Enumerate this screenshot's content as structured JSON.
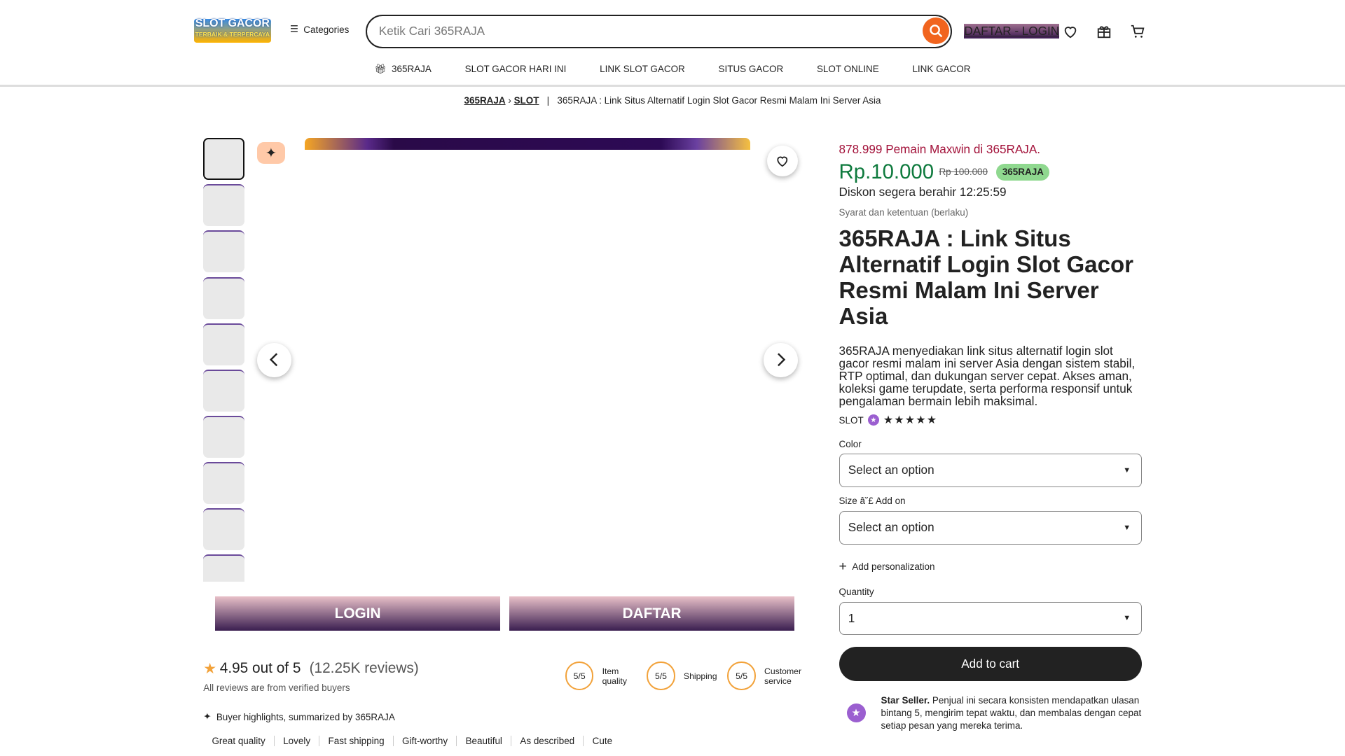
{
  "header": {
    "logo_text": "SLOT GACOR",
    "logo_sub": "TERBAIK & TERPERCAYA",
    "categories": "Categories",
    "search_placeholder": "Ketik Cari 365RAJA",
    "login_link": "DAFTAR - LOGIN"
  },
  "nav": [
    "365RAJA",
    "SLOT GACOR HARI INI",
    "LINK SLOT GACOR",
    "SITUS GACOR",
    "SLOT ONLINE",
    "LINK GACOR"
  ],
  "breadcrumb": {
    "items": [
      "365RAJA",
      "SLOT"
    ],
    "current": "365RAJA : Link Situs Alternatif Login Slot Gacor Resmi Malam Ini Server Asia",
    "sep": "|"
  },
  "gallery": {
    "login": "LOGIN",
    "daftar": "DAFTAR"
  },
  "reviews": {
    "score": "4.95 out of 5",
    "count": "(12.25K reviews)",
    "verified": "All reviews are from verified buyers",
    "scores": [
      {
        "v": "5/5",
        "l": "Item quality"
      },
      {
        "v": "5/5",
        "l": "Shipping"
      },
      {
        "v": "5/5",
        "l": "Customer service"
      }
    ],
    "highlights": "Buyer highlights, summarized by 365RAJA",
    "tags": [
      "Great quality",
      "Lovely",
      "Fast shipping",
      "Gift-worthy",
      "Beautiful",
      "As described",
      "Cute"
    ]
  },
  "product": {
    "promo": "878.999 Pemain Maxwin di 365RAJA.",
    "price": "Rp.10.000",
    "old_price": "Rp 100.000",
    "badge": "365RAJA",
    "discount": "Diskon segera berahir 12:25:59",
    "terms": "Syarat dan ketentuan (berlaku)",
    "title": "365RAJA : Link Situs Alternatif Login Slot Gacor Resmi Malam Ini Server Asia",
    "description": "365RAJA menyediakan link situs alternatif login slot gacor resmi malam ini server Asia dengan sistem stabil, RTP optimal, dan dukungan server cepat. Akses aman, koleksi game terupdate, serta performa responsif untuk pengalaman bermain lebih maksimal.",
    "shop": "SLOT",
    "stars": 5,
    "color_label": "Color",
    "color_value": "Select an option",
    "size_label": "Size â˘£ Add on",
    "size_value": "Select an option",
    "personalization": "Add personalization",
    "qty_label": "Quantity",
    "qty_value": "1",
    "cart": "Add to cart",
    "seller_title": "Star Seller.",
    "seller_text": " Penjual ini secara konsisten mendapatkan ulasan bintang 5, mengirim tepat waktu, dan membalas dengan cepat setiap pesan yang mereka terima."
  },
  "colors": {
    "accent": "#f1641e",
    "price": "#0e7a3d",
    "promo": "#a3123a",
    "badge": "#8fd88f"
  }
}
